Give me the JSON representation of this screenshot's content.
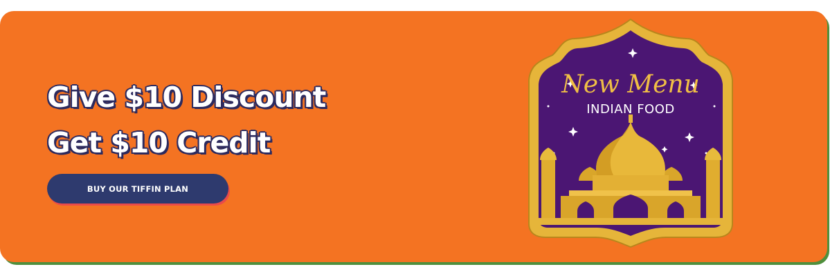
{
  "promo": {
    "headline_line1": "Give $10 Discount",
    "headline_line2": "Get $10 Credit",
    "cta_label": "BUY OUR TIFFIN PLAN"
  },
  "badge": {
    "title": "New Menu",
    "subtitle": "INDIAN FOOD"
  },
  "colors": {
    "banner_bg": "#f47322",
    "banner_edge": "#4f8f3d",
    "button_bg": "#2e3a6e",
    "badge_purple": "#4b1673",
    "badge_gold": "#e0ad2f"
  }
}
